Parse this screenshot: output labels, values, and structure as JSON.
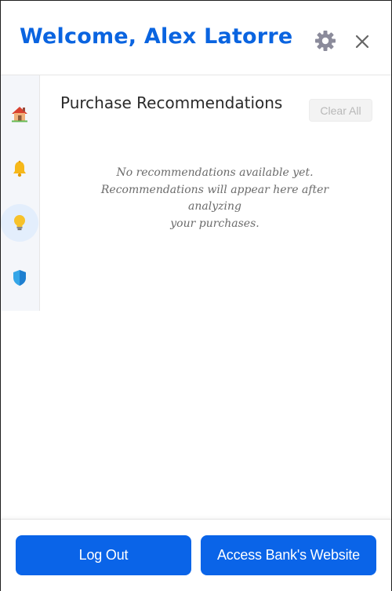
{
  "header": {
    "welcome_text": "Welcome, Alex Latorre",
    "settings_icon": "gear-icon",
    "close_icon": "close-icon"
  },
  "sidebar": {
    "items": [
      {
        "id": "home",
        "icon": "house-icon"
      },
      {
        "id": "notifications",
        "icon": "bell-icon"
      },
      {
        "id": "recommendations",
        "icon": "lightbulb-icon",
        "active": true
      },
      {
        "id": "security",
        "icon": "shield-icon"
      }
    ]
  },
  "main": {
    "title": "Purchase Recommendations",
    "clear_all_label": "Clear All",
    "empty_line1": "No recommendations available yet.",
    "empty_line2": "Recommendations will appear here after analyzing",
    "empty_line3": "your purchases."
  },
  "footer": {
    "logout_label": "Log Out",
    "bank_label": "Access Bank's Website"
  },
  "colors": {
    "accent": "#0a64e8",
    "title_blue": "#0a64e0",
    "sidebar_bg": "#f4f6fa",
    "active_nav_bg": "#e3eefc"
  }
}
